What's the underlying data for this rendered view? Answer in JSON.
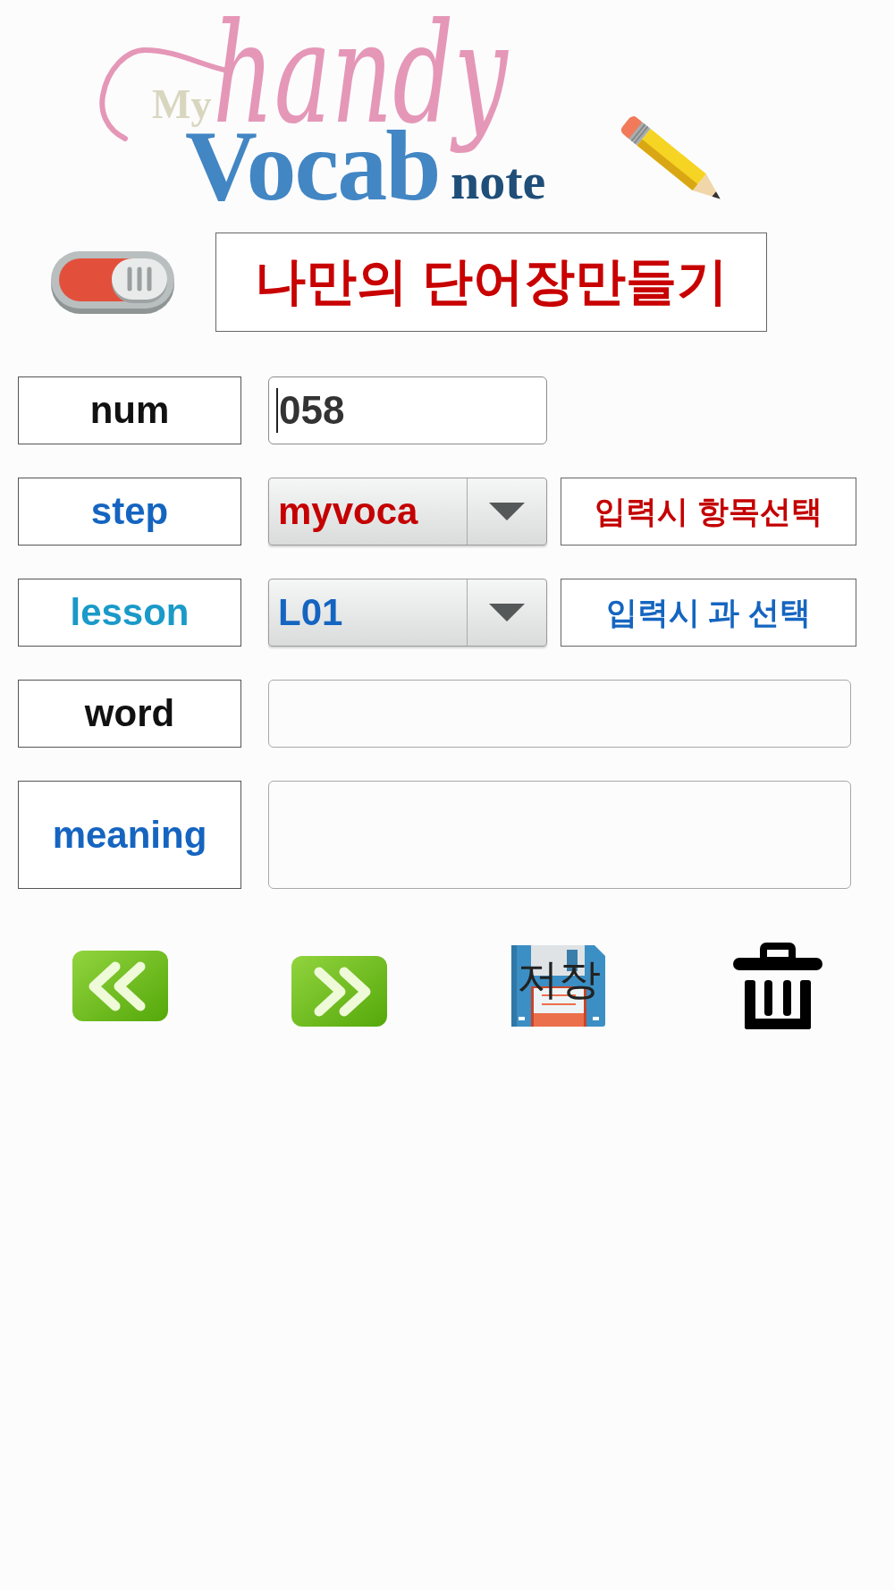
{
  "logo": {
    "small_word": "My",
    "script_word": "handy",
    "main_word": "Vocab",
    "tail_word": "note"
  },
  "toggle": {
    "on": true
  },
  "title": "나만의 단어장만들기",
  "fields": [
    {
      "kind": "number",
      "label": {
        "text": "num",
        "color": "#111111"
      },
      "value": "058",
      "focused": true
    },
    {
      "kind": "dropdown",
      "label": {
        "text": "step",
        "color": "#1565c0"
      },
      "value": {
        "text": "myvoca",
        "color": "#c40000"
      },
      "hint": {
        "text": "입력시 항목선택",
        "color": "#c40000"
      },
      "focused": false
    },
    {
      "kind": "dropdown",
      "label": {
        "text": "lesson",
        "color": "#1a9ac8"
      },
      "value": {
        "text": "L01",
        "color": "#1565c0"
      },
      "hint": {
        "text": "입력시 과 선택",
        "color": "#1565c0"
      },
      "focused": false
    },
    {
      "kind": "text",
      "label": {
        "text": "word",
        "color": "#111111"
      },
      "focused": false
    },
    {
      "kind": "textarea",
      "label": {
        "text": "meaning",
        "color": "#1565c0"
      },
      "focused": false
    }
  ],
  "buttons": [
    {
      "kind": "previous"
    },
    {
      "kind": "next"
    },
    {
      "kind": "save",
      "label": "저장"
    },
    {
      "kind": "delete"
    }
  ]
}
